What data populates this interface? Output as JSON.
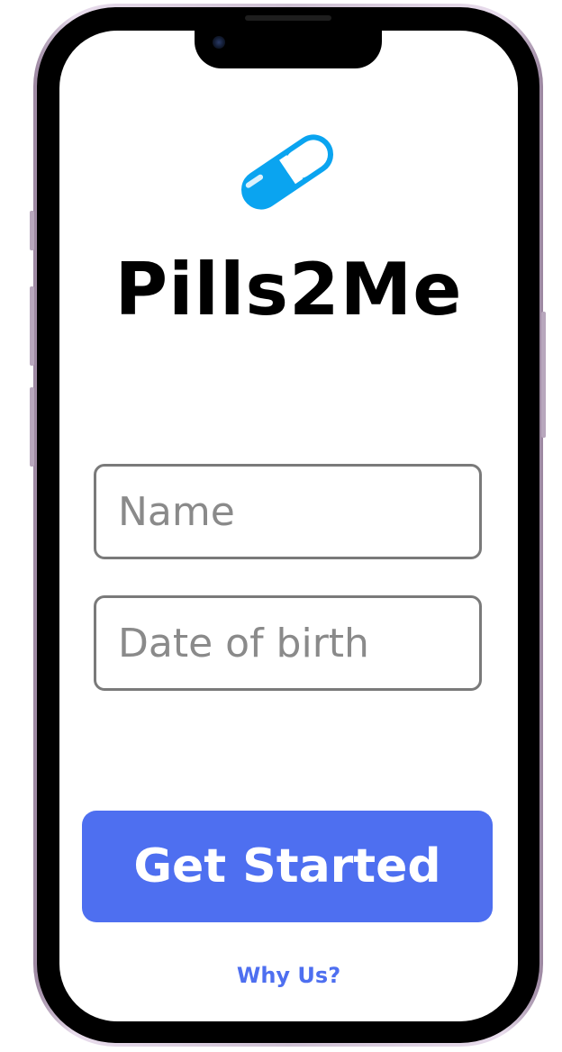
{
  "app": {
    "title": "Pills2Me",
    "logo_icon": "pill-capsule-icon",
    "accent_color": "#4e6ff0",
    "logo_color": "#0aa4f0"
  },
  "form": {
    "name_placeholder": "Name",
    "name_value": "",
    "dob_placeholder": "Date of birth",
    "dob_value": ""
  },
  "actions": {
    "get_started_label": "Get Started",
    "why_us_label": "Why Us?"
  }
}
